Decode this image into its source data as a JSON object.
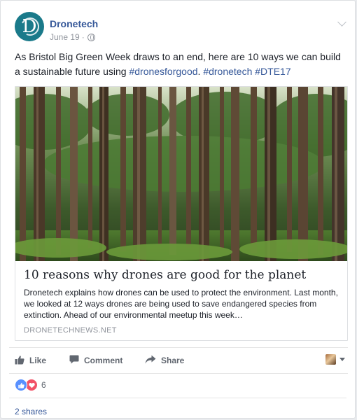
{
  "post": {
    "page_name": "Dronetech",
    "avatar_letter": "D",
    "date": "June 19",
    "separator": "·",
    "audience_icon": "globe-icon",
    "text_before": "As Bristol Big Green Week draws to an end, here are 10 ways we can build a sustainable future using ",
    "hashtags": [
      "#dronesforgood",
      "#dronetech",
      "#DTE17"
    ],
    "hashtag_separators": [
      ". ",
      " "
    ]
  },
  "link_preview": {
    "title": "10 reasons why drones are good for the planet",
    "description": "Dronetech explains how drones can be used to protect the environment. Last month, we looked at 12 ways drones are being used to save endangered species from extinction. Ahead of our environmental meetup this week…",
    "domain": "DRONETECHNEWS.NET",
    "image_subject": "forest-photo"
  },
  "actions": {
    "like_label": "Like",
    "comment_label": "Comment",
    "share_label": "Share"
  },
  "engagement": {
    "reaction_count": "6",
    "shares_text": "2 shares"
  },
  "colors": {
    "link_blue": "#365899",
    "like_blue": "#5890ff",
    "love_red": "#f25268",
    "avatar_teal": "#1a7a8a"
  }
}
